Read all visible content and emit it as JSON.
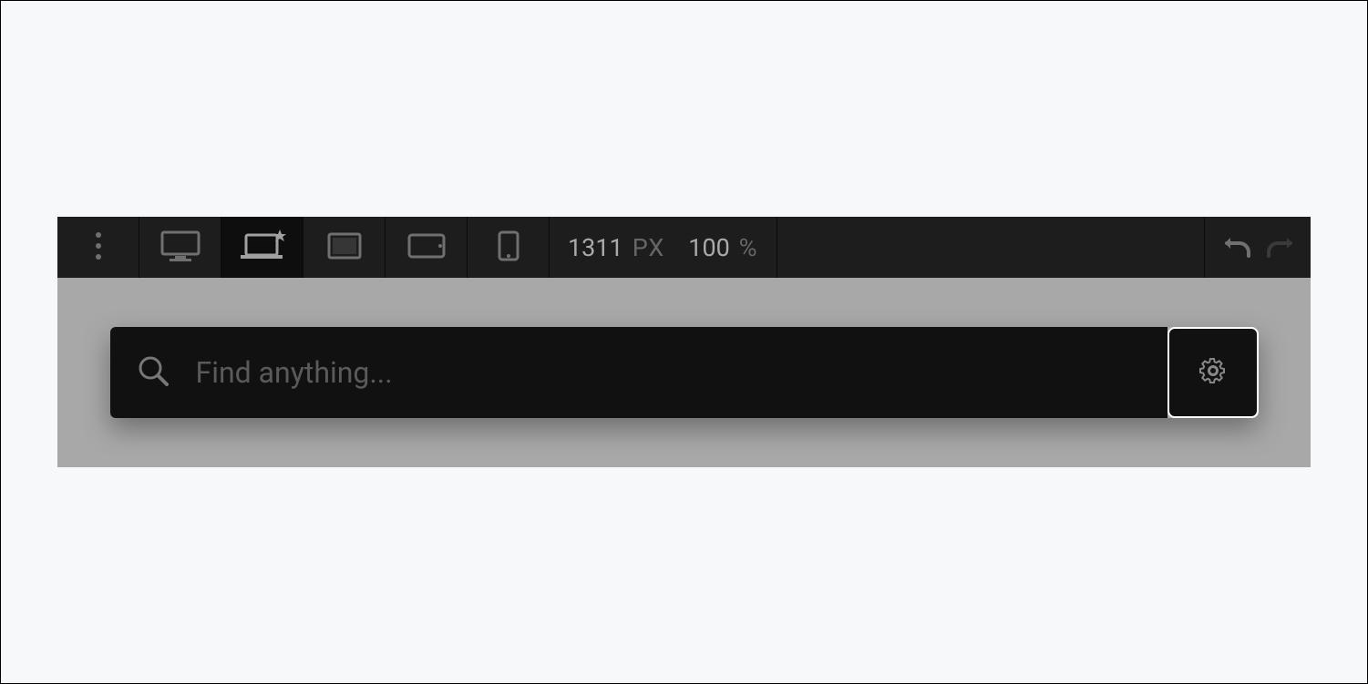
{
  "toolbar": {
    "width_value": "1311",
    "width_unit": "PX",
    "zoom_value": "100",
    "zoom_unit": "%",
    "devices": {
      "menu": "more-options",
      "desktop": "desktop",
      "laptop": "laptop",
      "tablet_landscape": "tablet-landscape",
      "tablet_portrait": "tablet-portrait",
      "phone": "phone"
    }
  },
  "search": {
    "placeholder": "Find anything..."
  }
}
